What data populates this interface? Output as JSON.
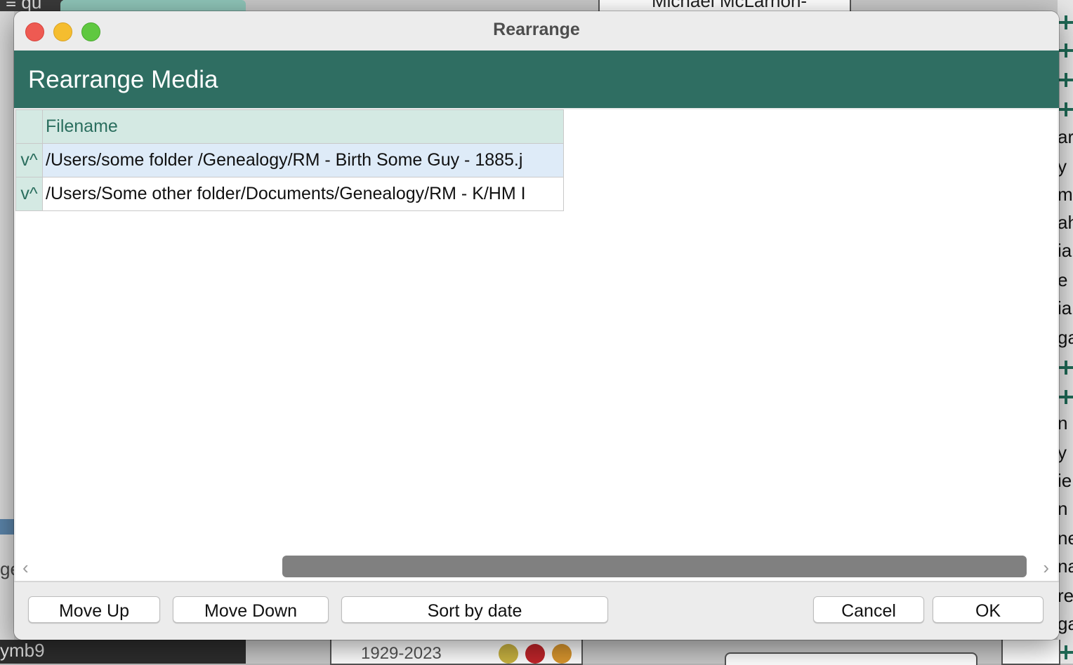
{
  "background": {
    "top_person_name": "Michael McLarnon-",
    "bottom_years": "1929-2023",
    "right_fragments": [
      "ary",
      "y",
      "m",
      "ah",
      "ia",
      "e",
      "ia",
      "ga",
      "n",
      "y",
      "ie",
      "n",
      "ne",
      "na",
      "re",
      "ga"
    ],
    "left_fragment": "ge",
    "bottom_left_fragment": "ymb9",
    "top_left_fragment": "≡ qu"
  },
  "window": {
    "title": "Rearrange",
    "header": "Rearrange Media"
  },
  "table": {
    "column_header": "Filename",
    "rows": [
      {
        "arrows": "v^",
        "filename": "/Users/some folder /Genealogy/RM - Birth Some Guy - 1885.j",
        "selected": true
      },
      {
        "arrows": "v^",
        "filename": "/Users/Some other folder/Documents/Genealogy/RM - K/HM I",
        "selected": false
      }
    ]
  },
  "scrollbar": {
    "left_arrow": "‹",
    "right_arrow": "›"
  },
  "buttons": {
    "move_up": "Move Up",
    "move_down": "Move Down",
    "sort_by_date": "Sort by date",
    "cancel": "Cancel",
    "ok": "OK"
  },
  "colors": {
    "header_band": "#2f6e62",
    "table_header_bg": "#d4e9e3",
    "selected_row": "#deebf8",
    "close": "#ee5a52",
    "minimize": "#f5bd2f",
    "zoom": "#5fc840"
  }
}
